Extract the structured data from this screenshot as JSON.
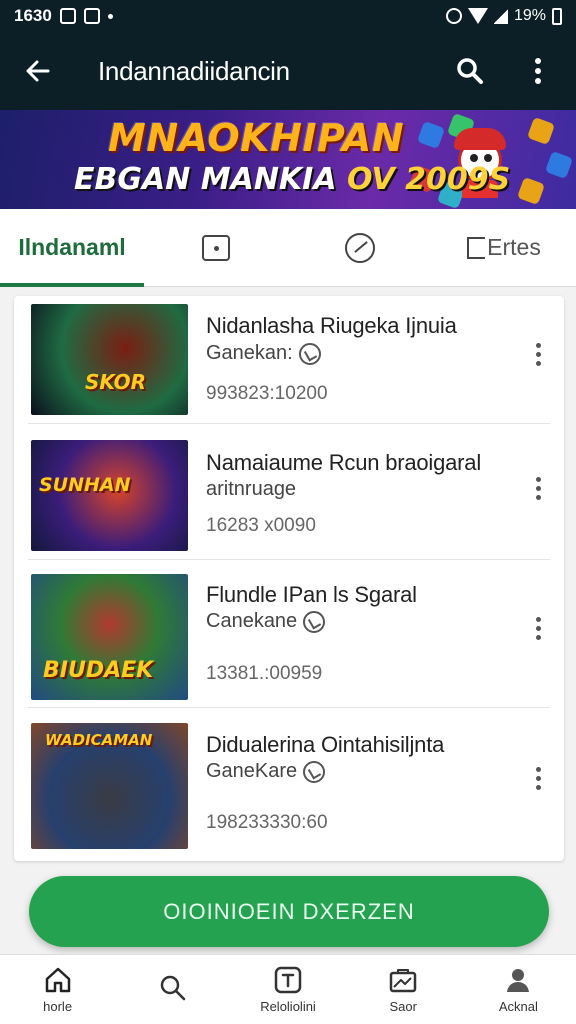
{
  "status_bar": {
    "time": "1630",
    "battery": "19%"
  },
  "app_bar": {
    "title": "Indannadiidancin"
  },
  "banner": {
    "headline": "MNAOKHIPAN",
    "subline_main": "EBGAN MANKIA",
    "subline_highlight": "OV 2009S"
  },
  "tabs": [
    {
      "label": "Ilndanaml",
      "active": true
    },
    {
      "label": "",
      "icon": "square-dot-icon",
      "active": false
    },
    {
      "label": "",
      "icon": "compass-icon",
      "active": false
    },
    {
      "label": "Ertes",
      "icon": "flag-icon",
      "active": false
    }
  ],
  "games": [
    {
      "title": "Nidanlasha Riugeka Ijnuia",
      "subtitle": "Ganekan:",
      "stats": "993823:10200",
      "thumb_text": "SKOR",
      "thumb_colors": [
        "#1f6b43",
        "#7a1e12",
        "#0b0f1c"
      ]
    },
    {
      "title": "Namaiaume Rcun braoigaral",
      "subtitle": "aritnruage",
      "stats": "16283 x0090",
      "thumb_text": "SUNHAN",
      "thumb_colors": [
        "#3b1d7a",
        "#d8442a",
        "#12183c"
      ]
    },
    {
      "title": "Flundle IPan ls Sgaral",
      "subtitle": "Canekane",
      "stats": "13381.:00959",
      "thumb_text": "BIUDAEK",
      "thumb_colors": [
        "#214a82",
        "#b13a2d",
        "#2f7a36"
      ]
    },
    {
      "title": "Didualerina Ointahisiljnta",
      "subtitle": "GaneKare",
      "stats": "198233330:60",
      "thumb_text": "WADICAMAN",
      "thumb_colors": [
        "#26406e",
        "#3a3b44",
        "#80462a"
      ]
    }
  ],
  "cta": {
    "label": "OIOINIOEIN DXERZEN"
  },
  "bottom_nav": [
    {
      "label": "horle",
      "icon": "home-icon"
    },
    {
      "label": "",
      "icon": "search-icon"
    },
    {
      "label": "Reloliolini",
      "icon": "text-box-icon"
    },
    {
      "label": "Saor",
      "icon": "store-icon"
    },
    {
      "label": "Acknal",
      "icon": "account-icon"
    }
  ],
  "colors": {
    "app_bar": "#0d1f26",
    "accent_green": "#24a24f",
    "active_tab": "#1e6b3c"
  }
}
